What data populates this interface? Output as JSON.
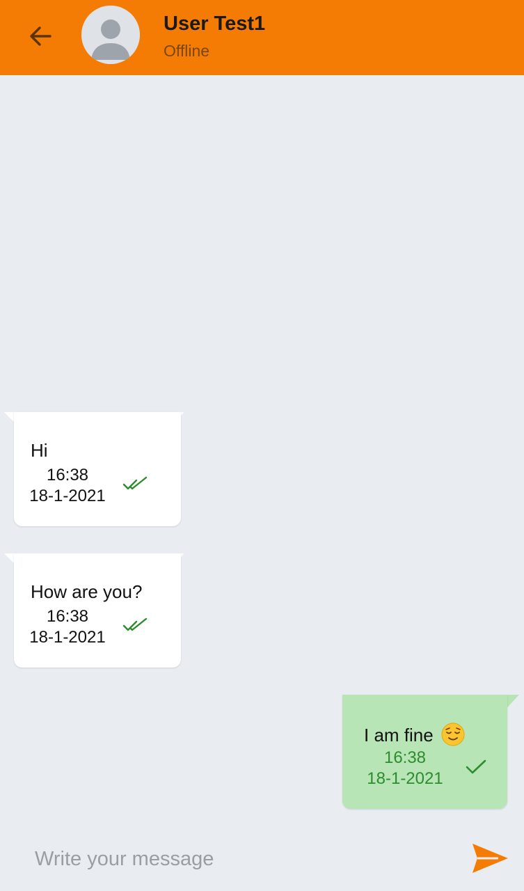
{
  "header": {
    "back_icon": "arrow-left-icon",
    "avatar_icon": "user-avatar-icon",
    "title": "User Test1",
    "status": "Offline",
    "color": "#f57c04"
  },
  "messages": [
    {
      "direction": "received",
      "text": "Hi",
      "time": "16:38",
      "date": "18-1-2021",
      "status_icon": "double-check-icon"
    },
    {
      "direction": "received",
      "text": "How are you?",
      "time": "16:38",
      "date": "18-1-2021",
      "status_icon": "double-check-icon"
    },
    {
      "direction": "sent",
      "text": "I am fine",
      "emoji": "relieved-face-emoji",
      "time": "16:38",
      "date": "18-1-2021",
      "status_icon": "single-check-icon"
    }
  ],
  "composer": {
    "placeholder": "Write your message",
    "value": "",
    "send_icon": "send-icon"
  },
  "colors": {
    "background": "#e9edf2",
    "received_bubble": "#ffffff",
    "sent_bubble": "#b7e5b6",
    "tick_green": "#2e8b2e"
  }
}
